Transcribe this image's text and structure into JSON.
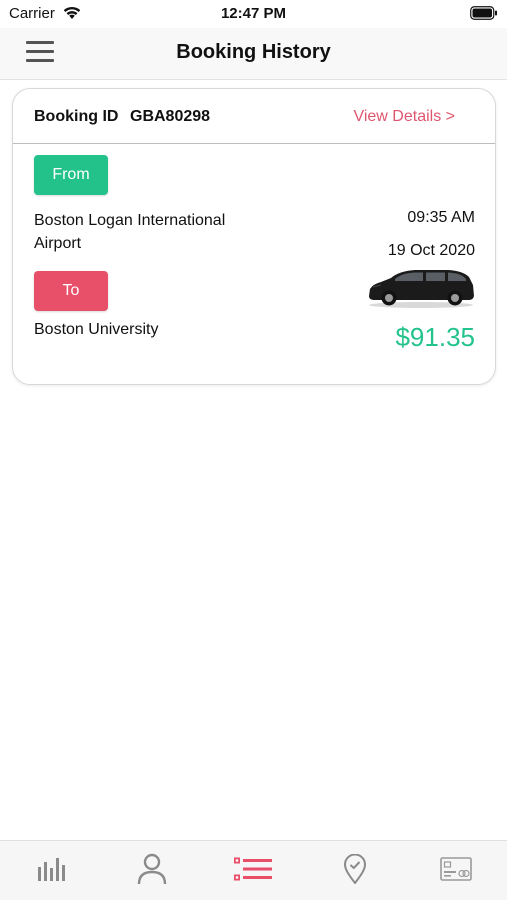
{
  "status_bar": {
    "carrier": "Carrier",
    "time": "12:47 PM"
  },
  "nav": {
    "title": "Booking History",
    "menu_icon": "hamburger-menu-icon"
  },
  "booking": {
    "id_label": "Booking ID",
    "id_value": "GBA80298",
    "view_details": "View Details >",
    "from_label": "From",
    "from_address": "Boston Logan International Airport",
    "to_label": "To",
    "to_address": "Boston University",
    "time": "09:35 AM",
    "date": "19 Oct 2020",
    "price": "$91.35",
    "vehicle_icon": "minivan-icon"
  },
  "tabs": [
    {
      "icon": "bar-chart-icon",
      "active": false
    },
    {
      "icon": "user-icon",
      "active": false
    },
    {
      "icon": "list-icon",
      "active": true
    },
    {
      "icon": "location-pin-icon",
      "active": false
    },
    {
      "icon": "payment-card-icon",
      "active": false
    }
  ],
  "colors": {
    "accent": "#e8506a",
    "from_green": "#22c28a",
    "price_green": "#23c38b",
    "link_pink": "#e0566f",
    "tab_inactive": "#8a8a8a"
  }
}
